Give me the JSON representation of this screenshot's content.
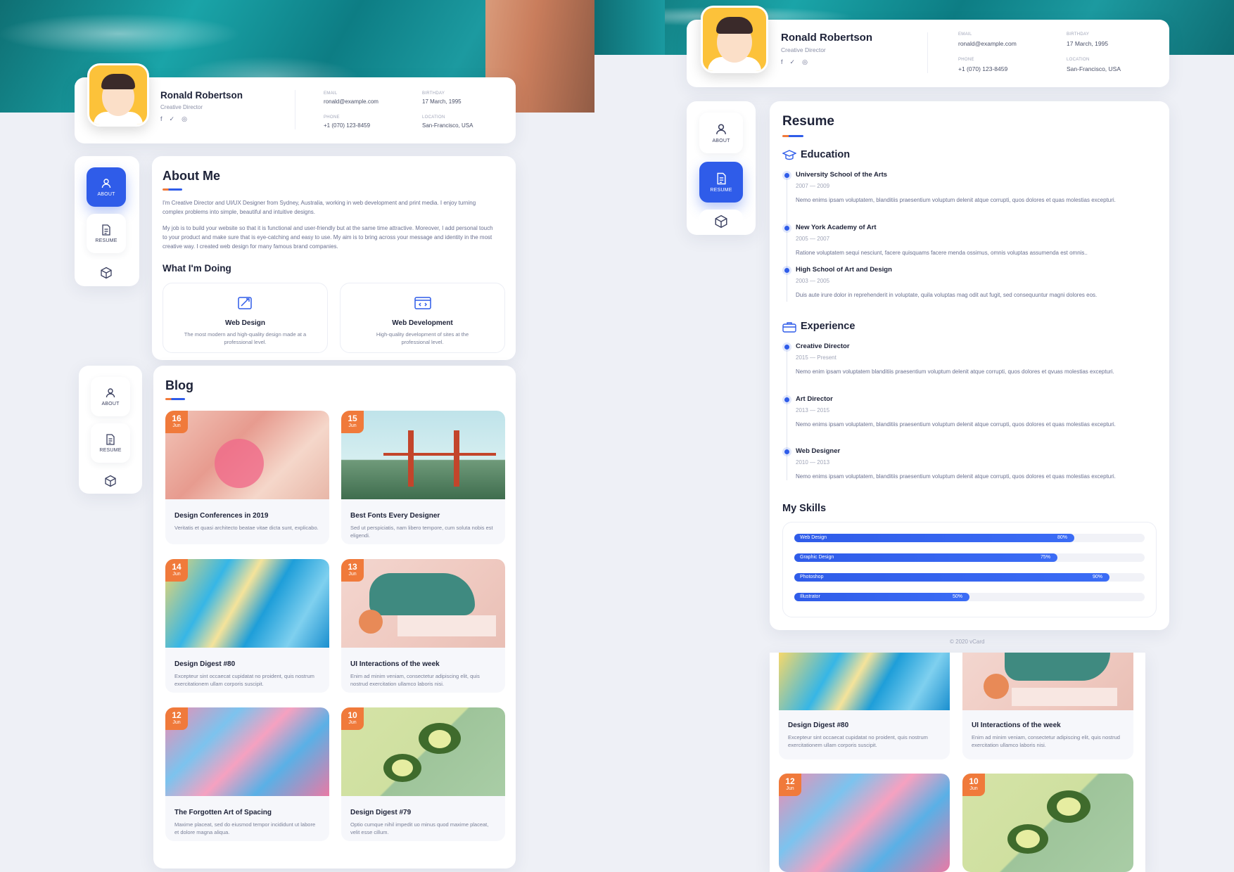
{
  "profile": {
    "name": "Ronald Robertson",
    "role": "Creative Director",
    "email_label": "EMAIL",
    "email": "ronald@example.com",
    "birthday_label": "BIRTHDAY",
    "birthday": "17 March, 1995",
    "phone_label": "PHONE",
    "phone": "+1 (070) 123-8459",
    "location_label": "LOCATION",
    "location_left": "San-Francisco, USA",
    "location_right": "San-Francisco, USA",
    "social": [
      "facebook-icon",
      "twitter-icon",
      "instagram-icon"
    ]
  },
  "nav": {
    "about": "ABOUT",
    "resume": "RESUME",
    "works_icon": "cube-icon"
  },
  "about": {
    "title": "About Me",
    "p1": "I'm Creative Director and UI/UX Designer from Sydney, Australia, working in web development and print media. I enjoy turning complex problems into simple, beautiful and intuitive designs.",
    "p2": "My job is to build your website so that it is functional and user-friendly but at the same time attractive. Moreover, I add personal touch to your product and make sure that is eye-catching and easy to use. My aim is to bring across your message and identity in the most creative way. I created web design for many famous brand companies.",
    "doing_title": "What I'm Doing",
    "services": [
      {
        "title": "Web Design",
        "desc": "The most modern and high-quality design made at a professional level."
      },
      {
        "title": "Web Development",
        "desc": "High-quality development of sites at the professional level."
      }
    ]
  },
  "blog": {
    "title": "Blog",
    "posts": [
      {
        "day": "16",
        "month": "Jun",
        "title": "Design Conferences in 2019",
        "excerpt": "Veritatis et quasi architecto beatae vitae dicta sunt, explicabo."
      },
      {
        "day": "15",
        "month": "Jun",
        "title": "Best Fonts Every Designer",
        "excerpt": "Sed ut perspiciatis, nam libero tempore, cum soluta nobis est eligendi."
      },
      {
        "day": "14",
        "month": "Jun",
        "title": "Design Digest #80",
        "excerpt": "Excepteur sint occaecat cupidatat no proident, quis nostrum exercitationem ullam corporis suscipit."
      },
      {
        "day": "13",
        "month": "Jun",
        "title": "UI Interactions of the week",
        "excerpt": "Enim ad minim veniam, consectetur adipiscing elit, quis nostrud exercitation ullamco laboris nisi."
      },
      {
        "day": "12",
        "month": "Jun",
        "title": "The Forgotten Art of Spacing",
        "excerpt": "Maxime placeat, sed do eiusmod tempor incididunt ut labore et dolore magna aliqua."
      },
      {
        "day": "10",
        "month": "Jun",
        "title": "Design Digest #79",
        "excerpt": "Optio cumque nihil impedit uo minus quod maxime placeat, velit esse cillum."
      }
    ]
  },
  "resume": {
    "title": "Resume",
    "education_title": "Education",
    "education": [
      {
        "title": "University School of the Arts",
        "years": "2007 — 2009",
        "desc": "Nemo enims ipsam voluptatem, blanditiis praesentium voluptum delenit atque corrupti, quos dolores et quas molestias excepturi."
      },
      {
        "title": "New York Academy of Art",
        "years": "2005 — 2007",
        "desc": "Ratione voluptatem sequi nesciunt, facere quisquams facere menda ossimus, omnis voluptas assumenda est omnis.."
      },
      {
        "title": "High School of Art and Design",
        "years": "2003 — 2005",
        "desc": "Duis aute irure dolor in reprehenderit in voluptate, quila voluptas mag odit aut fugit, sed consequuntur magni dolores eos."
      }
    ],
    "experience_title": "Experience",
    "experience": [
      {
        "title": "Creative Director",
        "years": "2015 — Present",
        "desc": "Nemo enim ipsam voluptatem blanditiis praesentium voluptum delenit atque corrupti, quos dolores et qvuas molestias excepturi."
      },
      {
        "title": "Art Director",
        "years": "2013 — 2015",
        "desc": "Nemo enims ipsam voluptatem, blanditiis praesentium voluptum delenit atque corrupti, quos dolores et quas molestias excepturi."
      },
      {
        "title": "Web Designer",
        "years": "2010 — 2013",
        "desc": "Nemo enims ipsam voluptatem, blanditiis praesentium voluptum delenit atque corrupti, quos dolores et quas molestias excepturi."
      }
    ],
    "skills_title": "My Skills",
    "skills": [
      {
        "name": "Web Design",
        "pct": "80%",
        "level": 0.8
      },
      {
        "name": "Graphic Design",
        "pct": "75%",
        "level": 0.75
      },
      {
        "name": "Photoshop",
        "pct": "90%",
        "level": 0.9
      },
      {
        "name": "Illustrator",
        "pct": "50%",
        "level": 0.5
      }
    ],
    "footer": "© 2020 vCard"
  },
  "colors": {
    "accent": "#2f5ce9",
    "orange": "#f07a3b"
  }
}
